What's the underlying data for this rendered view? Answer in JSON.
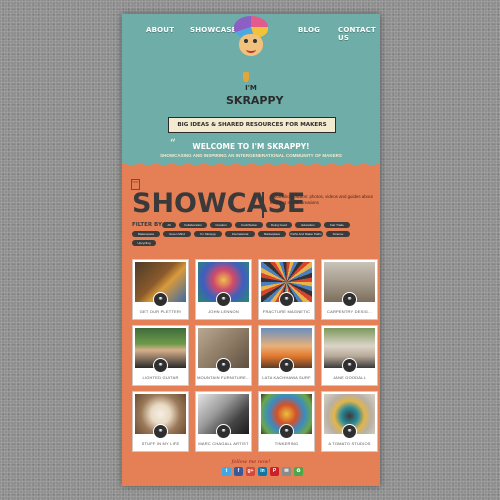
{
  "nav": {
    "about": "ABOUT",
    "showcase": "SHOWCASE",
    "blog": "BLOG",
    "contact": "CONTACT US"
  },
  "logo": {
    "small": "I'M",
    "text": "SKRAPPY"
  },
  "banner": "BIG IDEAS & SHARED RESOURCES FOR MAKERS",
  "welcome": {
    "quote": "“",
    "title": "WELCOME TO I'M SKRAPPY!",
    "tagline": "SHOWCASING AND INSPIRING AN INTERGENERATIONAL COMMUNITY OF MAKERS"
  },
  "showcase": {
    "page_icon": "PDF",
    "title": "SHOWCASE",
    "description": "A portfolio in action: photos, videos and guides about inspiring maker creations",
    "filter_label": "FILTER BY",
    "filters": [
      "All",
      "Collaboration",
      "Creation",
      "Contribution",
      "Doing Good",
      "Education",
      "Fair Trade",
      "Makerspace",
      "Green Mind",
      "I'm Skrappy",
      "International",
      "Marketplace",
      "Paths And Maker Paths",
      "Science",
      "Upcycling"
    ]
  },
  "cards": [
    {
      "label": "GET OUR PLETTER!"
    },
    {
      "label": "JOHN LENNON"
    },
    {
      "label": "FRACTURE MAGNETIC"
    },
    {
      "label": "CARPENTRY DESIG..."
    },
    {
      "label": "LIGHTED GUITAR"
    },
    {
      "label": "MOUNTAIN FURNITURE..."
    },
    {
      "label": "LATA KACHHAWA SURF"
    },
    {
      "label": "JANE GOODALL"
    },
    {
      "label": "STUFF IN MY LIFE"
    },
    {
      "label": "MARC CHAGALL ARTIST"
    },
    {
      "label": "TINKERING"
    },
    {
      "label": "A TOMATO STUDIOS"
    }
  ],
  "footer": {
    "follow": "follow me now!",
    "social": [
      "t",
      "f",
      "g+",
      "in",
      "P",
      "✉",
      "♻"
    ]
  },
  "colors": {
    "header_bg": "#6fada8",
    "main_bg": "#e57f55",
    "chip_bg": "#3b3b3b"
  },
  "icons": {
    "card_link": "link-icon"
  }
}
